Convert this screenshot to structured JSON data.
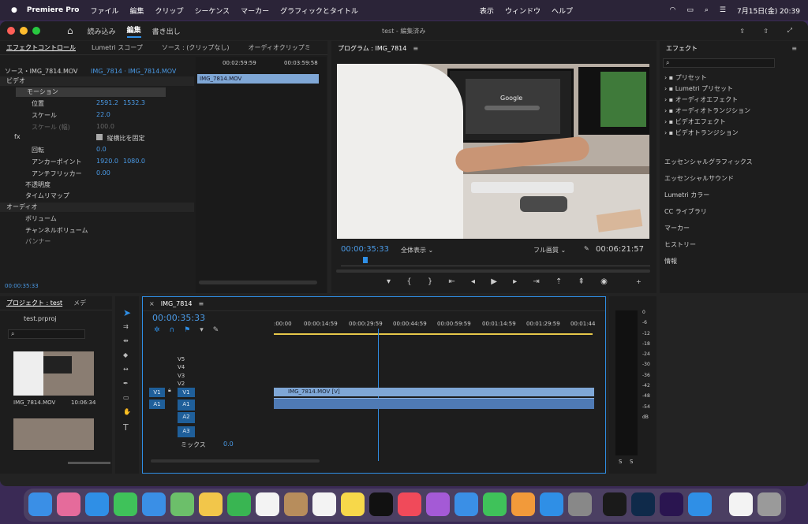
{
  "menubar": {
    "app": "Premiere Pro",
    "items": [
      "ファイル",
      "編集",
      "クリップ",
      "シーケンス",
      "マーカー",
      "グラフィックとタイトル",
      "表示",
      "ウィンドウ",
      "ヘルプ"
    ],
    "datetime": "7月15日(金)  20:39"
  },
  "workspace": {
    "tabs": [
      "読み込み",
      "編集",
      "書き出し"
    ],
    "title": "test - 編集済み"
  },
  "effect_controls": {
    "tabs": [
      "エフェクトコントロール",
      "Lumetri スコープ",
      "ソース : (クリップなし)",
      "オーディオクリップミ"
    ],
    "source": "ソース・IMG_7814.MOV",
    "clip": "IMG_7814 · IMG_7814.MOV",
    "section_video": "ビデオ",
    "motion": "モーション",
    "props": [
      {
        "name": "位置",
        "v1": "2591.2",
        "v2": "1532.3"
      },
      {
        "name": "スケール",
        "v1": "22.0"
      },
      {
        "name": "スケール (幅)",
        "v1": "100.0"
      },
      {
        "name": "縦横比を固定"
      },
      {
        "name": "回転",
        "v1": "0.0"
      },
      {
        "name": "アンカーポイント",
        "v1": "1920.0",
        "v2": "1080.0"
      },
      {
        "name": "アンチフリッカー",
        "v1": "0.00"
      }
    ],
    "opacity": "不透明度",
    "timeremap": "タイムリマップ",
    "section_audio": "オーディオ",
    "volume": "ボリューム",
    "channel_volume": "チャンネルボリューム",
    "panner": "パンナー",
    "timecode": "00:00:35:33",
    "mini_tl": {
      "t1": "00:02:59:59",
      "t2": "00:03:59:58",
      "clip": "IMG_7814.MOV"
    }
  },
  "program": {
    "title": "プログラム : IMG_7814",
    "timecode": "00:00:35:33",
    "fit": "全体表示",
    "quality": "フル画質",
    "duration": "00:06:21:57",
    "monitor_text": "Google"
  },
  "effects": {
    "title": "エフェクト",
    "tree": [
      "プリセット",
      "Lumetri プリセット",
      "オーディオエフェクト",
      "オーディオトランジション",
      "ビデオエフェクト",
      "ビデオトランジション"
    ],
    "panels": [
      "エッセンシャルグラフィックス",
      "エッセンシャルサウンド",
      "Lumetri カラー",
      "CC ライブラリ",
      "マーカー",
      "ヒストリー",
      "情報"
    ]
  },
  "project": {
    "tabs": [
      "プロジェクト : test",
      "メデ"
    ],
    "file": "test.prproj",
    "items": [
      {
        "name": "IMG_7814.MOV",
        "dur": "10:06:34"
      }
    ]
  },
  "timeline": {
    "title": "IMG_7814",
    "timecode": "00:00:35:33",
    "ruler": [
      ":00:00",
      "00:00:14:59",
      "00:00:29:59",
      "00:00:44:59",
      "00:00:59:59",
      "00:01:14:59",
      "00:01:29:59",
      "00:01:44"
    ],
    "video_tracks": [
      "V5",
      "V4",
      "V3",
      "V2",
      "V1"
    ],
    "audio_tracks": [
      "A1",
      "A2",
      "A3"
    ],
    "mix": "ミックス",
    "mix_val": "0.0",
    "clip": "IMG_7814.MOV [V]",
    "src_v": "V1",
    "src_a": "A1"
  },
  "meter": {
    "scale": [
      "0",
      "-6",
      "-12",
      "-18",
      "-24",
      "-30",
      "-36",
      "-42",
      "-48",
      "-54",
      "dB"
    ],
    "solo": [
      "S",
      "S"
    ]
  },
  "colors": {
    "accent": "#2f8fe6",
    "clip_video": "#7fa7d6",
    "clip_audio": "#4f7ab4",
    "yellow": "#e6c84a"
  }
}
